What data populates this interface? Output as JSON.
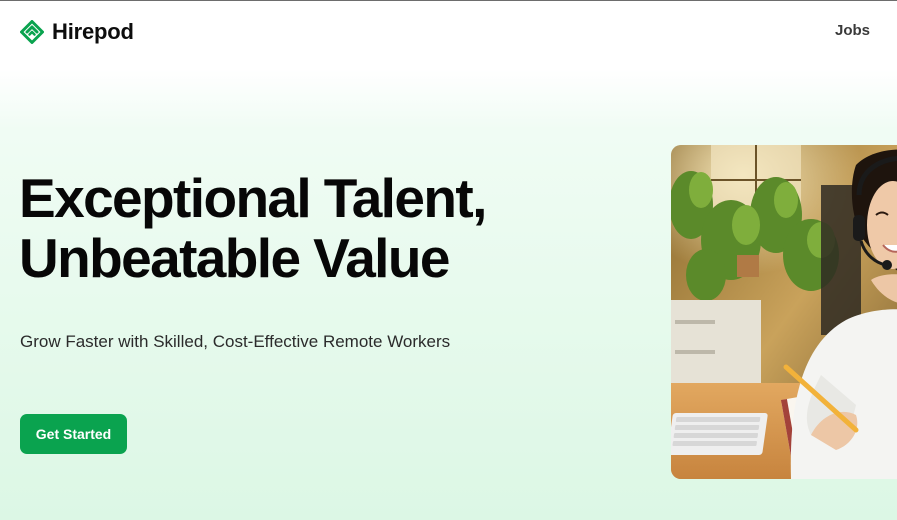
{
  "brand": {
    "name": "Hirepod",
    "accent": "#0aa34f"
  },
  "nav": {
    "jobs_label": "Jobs"
  },
  "hero": {
    "title_line1": "Exceptional Talent,",
    "title_line2": "Unbeatable Value",
    "subtitle": "Grow Faster with Skilled, Cost-Effective Remote Workers",
    "cta_label": "Get Started",
    "image_description": "woman-with-headset-writing-at-desk-photo"
  }
}
